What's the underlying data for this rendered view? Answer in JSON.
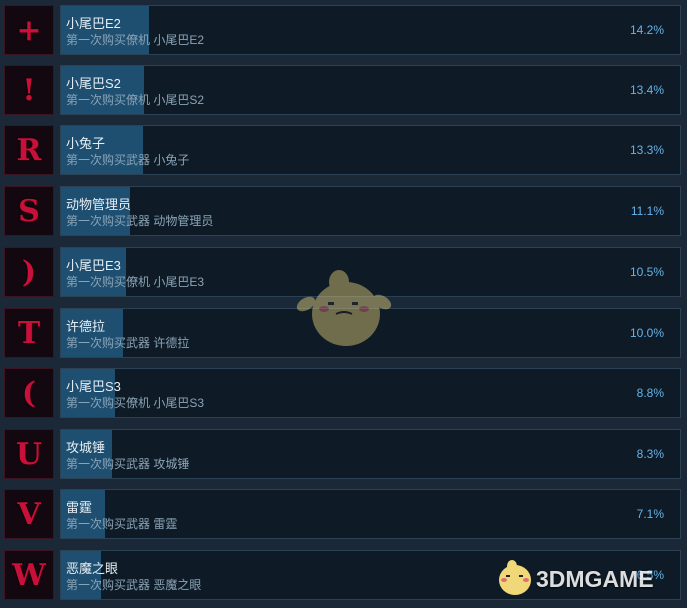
{
  "achievements": [
    {
      "icon": "+",
      "title": "小尾巴E2",
      "desc": "第一次购买僚机 小尾巴E2",
      "pct_label": "14.2%",
      "pct": 14.2
    },
    {
      "icon": "!",
      "title": "小尾巴S2",
      "desc": "第一次购买僚机 小尾巴S2",
      "pct_label": "13.4%",
      "pct": 13.4
    },
    {
      "icon": "R",
      "title": "小兔子",
      "desc": "第一次购买武器 小兔子",
      "pct_label": "13.3%",
      "pct": 13.3
    },
    {
      "icon": "S",
      "title": "动物管理员",
      "desc": "第一次购买武器 动物管理员",
      "pct_label": "11.1%",
      "pct": 11.1
    },
    {
      "icon": ")",
      "title": "小尾巴E3",
      "desc": "第一次购买僚机 小尾巴E3",
      "pct_label": "10.5%",
      "pct": 10.5
    },
    {
      "icon": "T",
      "title": "许德拉",
      "desc": "第一次购买武器 许德拉",
      "pct_label": "10.0%",
      "pct": 10.0
    },
    {
      "icon": "(",
      "title": "小尾巴S3",
      "desc": "第一次购买僚机 小尾巴S3",
      "pct_label": "8.8%",
      "pct": 8.8
    },
    {
      "icon": "U",
      "title": "攻城锤",
      "desc": "第一次购买武器 攻城锤",
      "pct_label": "8.3%",
      "pct": 8.3
    },
    {
      "icon": "V",
      "title": "雷霆",
      "desc": "第一次购买武器 雷霆",
      "pct_label": "7.1%",
      "pct": 7.1
    },
    {
      "icon": "W",
      "title": "恶魔之眼",
      "desc": "第一次购买武器 恶魔之眼",
      "pct_label": "6.5%",
      "pct": 6.5
    }
  ],
  "watermark": {
    "text": "3DMGAME",
    "icon": "mascot-logo-icon"
  },
  "colors": {
    "background": "#1b2838",
    "progress": "#1e4f71",
    "percent": "#67b2e8",
    "icon_glyph": "#c8103a"
  }
}
